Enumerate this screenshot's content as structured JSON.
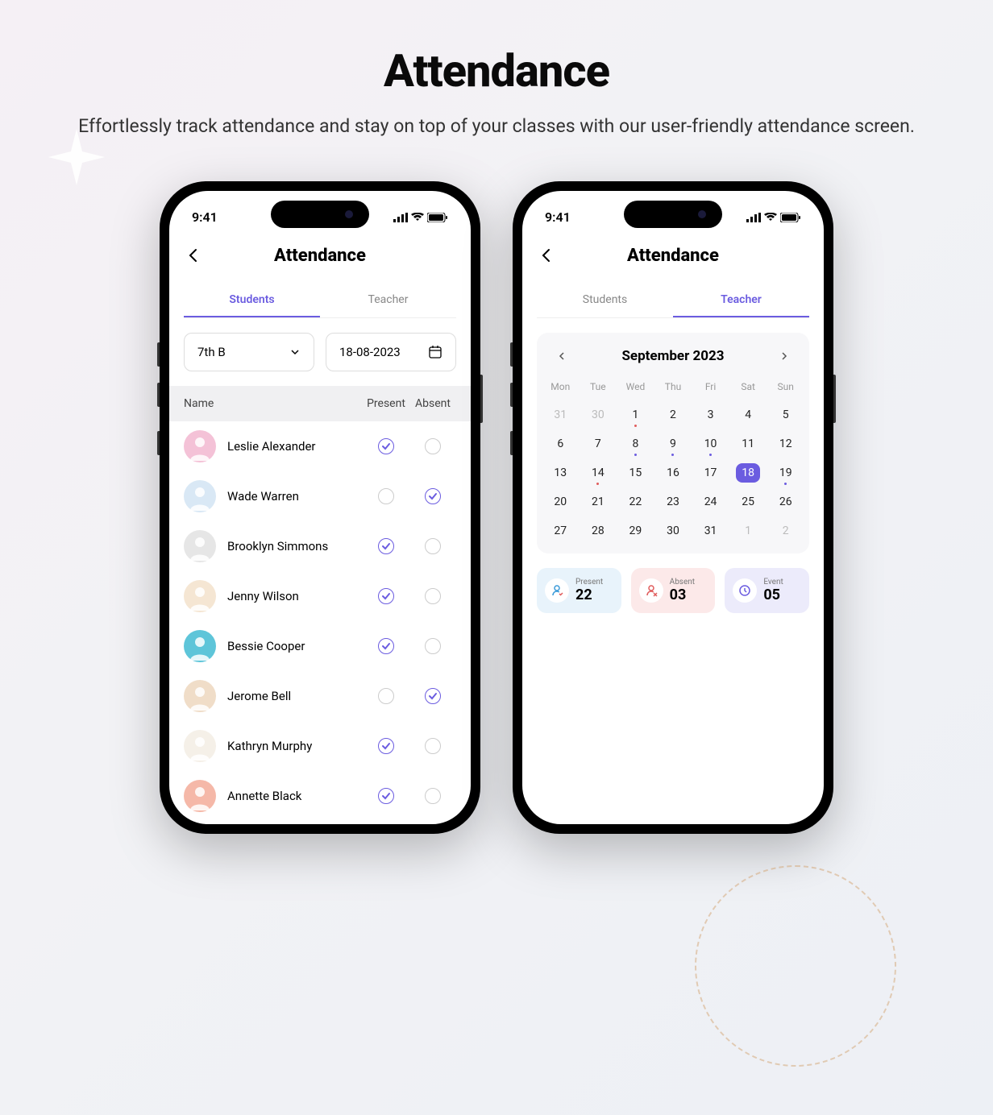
{
  "hero": {
    "title": "Attendance",
    "subtitle": "Effortlessly track attendance and stay on top of your classes with our user-friendly attendance screen."
  },
  "status_time": "9:41",
  "screen_title": "Attendance",
  "tabs": {
    "students": "Students",
    "teacher": "Teacher"
  },
  "filters": {
    "class": "7th B",
    "date": "18-08-2023"
  },
  "columns": {
    "name": "Name",
    "present": "Present",
    "absent": "Absent"
  },
  "students": [
    {
      "name": "Leslie Alexander",
      "status": "present",
      "bg": "#f4c2d7"
    },
    {
      "name": "Wade Warren",
      "status": "absent",
      "bg": "#d9e8f5"
    },
    {
      "name": "Brooklyn Simmons",
      "status": "present",
      "bg": "#e6e6e6"
    },
    {
      "name": "Jenny Wilson",
      "status": "present",
      "bg": "#f5e6d3"
    },
    {
      "name": "Bessie Cooper",
      "status": "present",
      "bg": "#5ec5d9"
    },
    {
      "name": "Jerome Bell",
      "status": "absent",
      "bg": "#f0ddc8"
    },
    {
      "name": "Kathryn Murphy",
      "status": "present",
      "bg": "#f5f0e8"
    },
    {
      "name": "Annette Black",
      "status": "present",
      "bg": "#f5b8a8"
    }
  ],
  "calendar": {
    "month_label": "September 2023",
    "dow": [
      "Mon",
      "Tue",
      "Wed",
      "Thu",
      "Fri",
      "Sat",
      "Sun"
    ],
    "cells": [
      {
        "d": "31",
        "muted": true
      },
      {
        "d": "30",
        "muted": true
      },
      {
        "d": "1",
        "dots": [
          "r"
        ]
      },
      {
        "d": "2"
      },
      {
        "d": "3"
      },
      {
        "d": "4"
      },
      {
        "d": "5"
      },
      {
        "d": "6"
      },
      {
        "d": "7"
      },
      {
        "d": "8",
        "dots": [
          "b"
        ]
      },
      {
        "d": "9",
        "dots": [
          "b"
        ]
      },
      {
        "d": "10",
        "dots": [
          "b"
        ]
      },
      {
        "d": "11"
      },
      {
        "d": "12"
      },
      {
        "d": "13"
      },
      {
        "d": "14",
        "dots": [
          "r"
        ]
      },
      {
        "d": "15"
      },
      {
        "d": "16"
      },
      {
        "d": "17"
      },
      {
        "d": "18",
        "sel": true
      },
      {
        "d": "19",
        "dots": [
          "b"
        ]
      },
      {
        "d": "20"
      },
      {
        "d": "21"
      },
      {
        "d": "22"
      },
      {
        "d": "23"
      },
      {
        "d": "24"
      },
      {
        "d": "25"
      },
      {
        "d": "26"
      },
      {
        "d": "27"
      },
      {
        "d": "28"
      },
      {
        "d": "29"
      },
      {
        "d": "30"
      },
      {
        "d": "31"
      },
      {
        "d": "1",
        "muted": true
      },
      {
        "d": "2",
        "muted": true
      }
    ]
  },
  "stats": {
    "present": {
      "label": "Present",
      "value": "22"
    },
    "absent": {
      "label": "Absent",
      "value": "03"
    },
    "event": {
      "label": "Event",
      "value": "05"
    }
  }
}
